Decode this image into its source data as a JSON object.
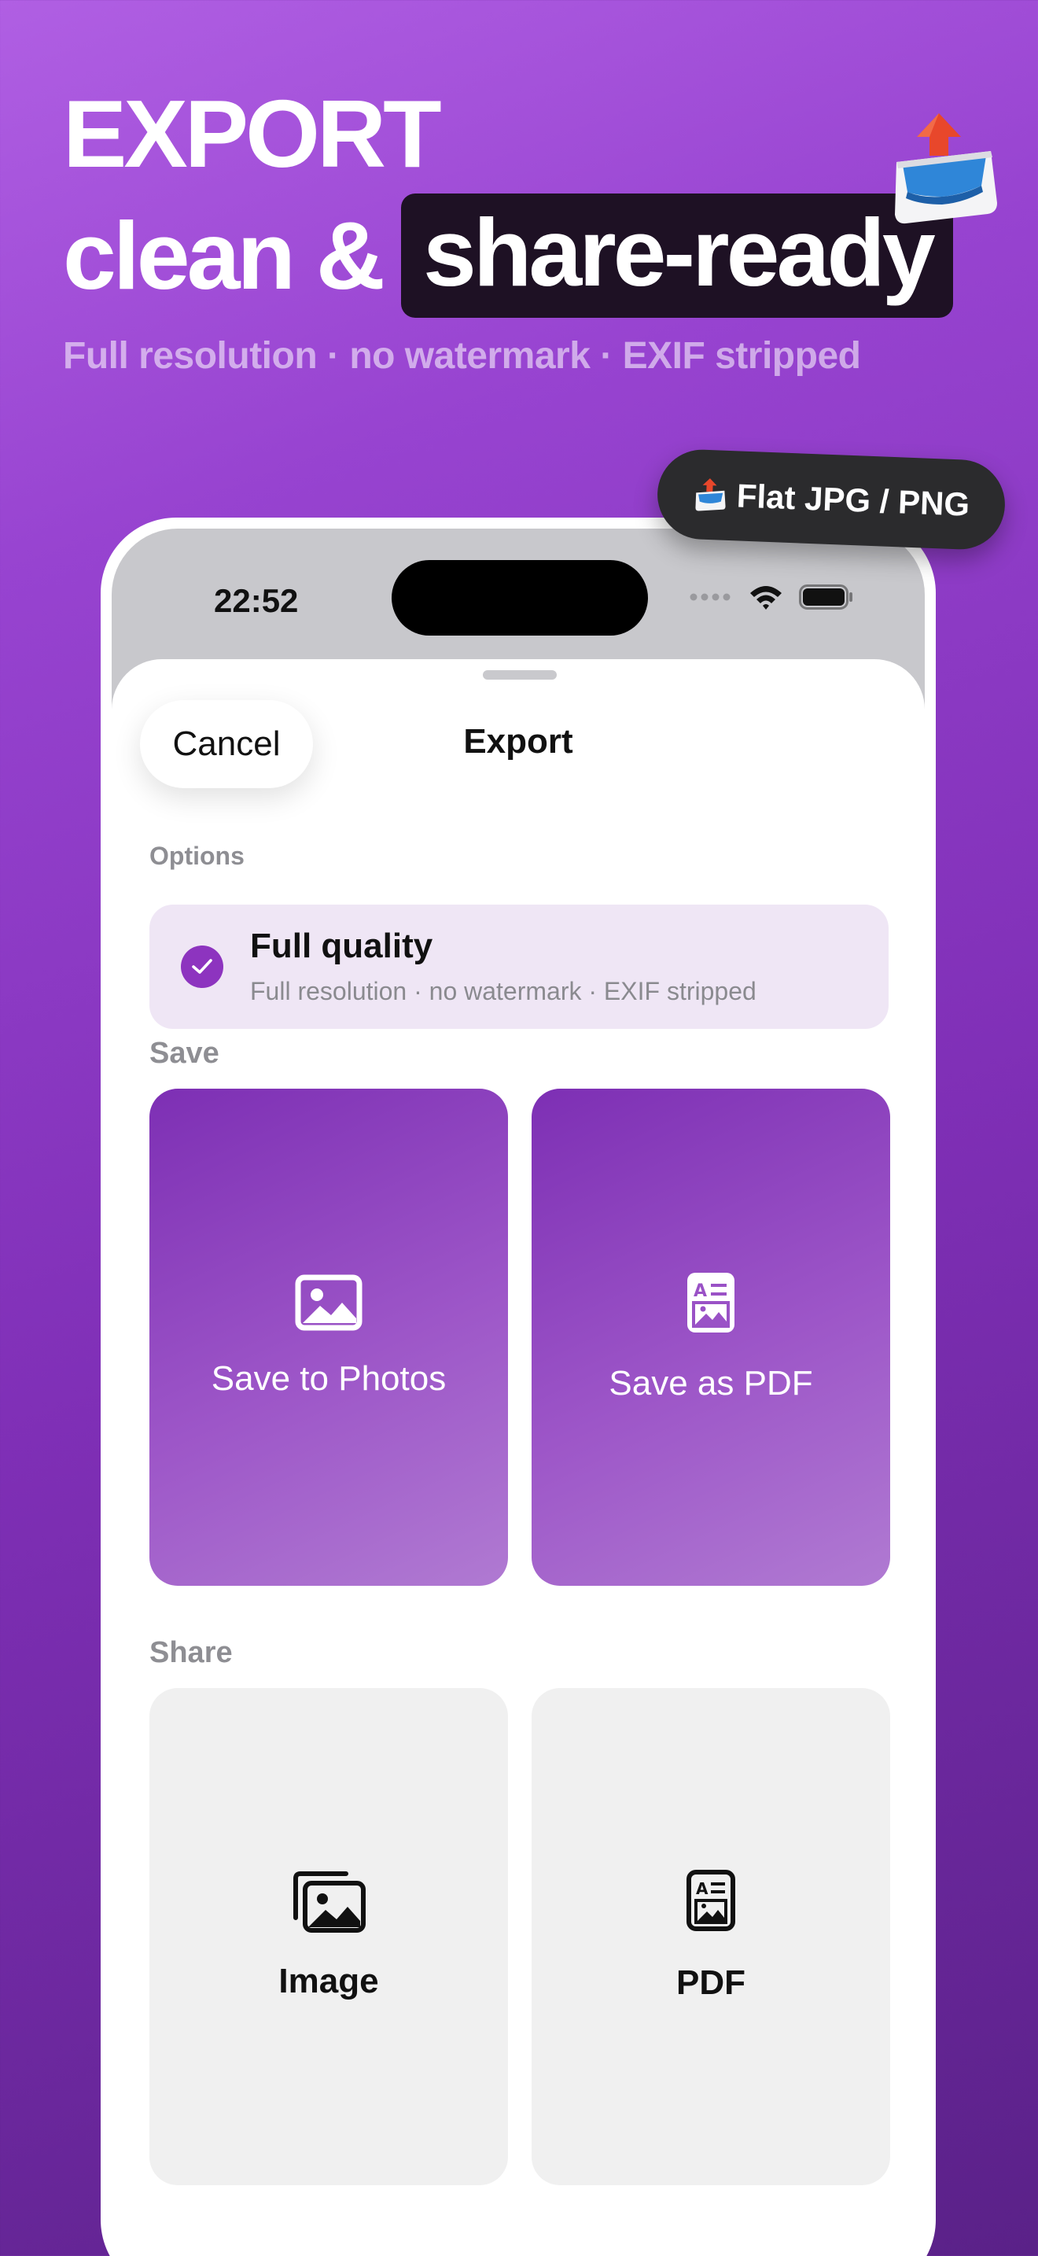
{
  "hero": {
    "line1": "EXPORT",
    "line2_plain": "clean &",
    "line2_highlight": "share-ready",
    "subtitle": "Full resolution · no watermark · EXIF stripped"
  },
  "badge": {
    "label": "Flat JPG / PNG"
  },
  "status_bar": {
    "time": "22:52"
  },
  "sheet": {
    "cancel_label": "Cancel",
    "title": "Export",
    "options_label": "Options",
    "option": {
      "title": "Full quality",
      "description": "Full resolution · no watermark · EXIF stripped",
      "checked": true
    },
    "save_label": "Save",
    "save_actions": [
      {
        "label": "Save to Photos",
        "icon": "photo-icon"
      },
      {
        "label": "Save as PDF",
        "icon": "pdf-document-icon"
      }
    ],
    "share_label": "Share",
    "share_actions": [
      {
        "label": "Image",
        "icon": "photo-stack-icon"
      },
      {
        "label": "PDF",
        "icon": "pdf-document-icon"
      }
    ]
  },
  "colors": {
    "accent": "#8d34bf",
    "background_top": "#b05fe3",
    "background_bottom": "#5a2188",
    "highlight_bg": "#1e1124",
    "badge_bg": "#2b2b2d"
  }
}
